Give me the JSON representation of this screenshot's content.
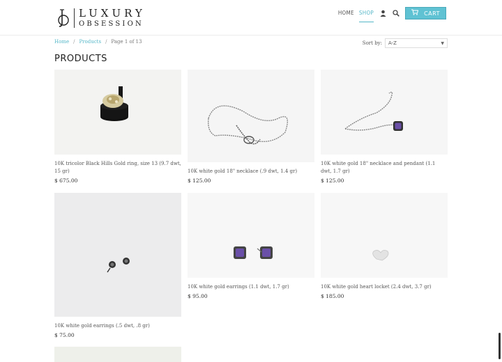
{
  "brand": {
    "line1": "LUXURY",
    "line2": "OBSESSION"
  },
  "nav": {
    "home": "HOME",
    "shop": "SHOP",
    "account_icon": "user-icon",
    "search_icon": "search-icon",
    "cart_label": "CART",
    "cart_icon": "cart-icon",
    "accent_color": "#5fc2d3"
  },
  "breadcrumb": {
    "home": "Home",
    "products": "Products",
    "page": "Page 1 of 13"
  },
  "sort": {
    "label": "Sort by:",
    "value": "A-Z"
  },
  "page_title": "PRODUCTS",
  "products": [
    {
      "name": "10K tricolor Black Hills Gold ring, size 13 (9.7 dwt, 15 gr)",
      "price": "$ 675.00"
    },
    {
      "name": "10K white gold 18\" necklace (.9 dwt, 1.4 gr)",
      "price": "$ 125.00"
    },
    {
      "name": "10K white gold 18\" necklace and pendant (1.1 dwt, 1.7 gr)",
      "price": "$ 125.00"
    },
    {
      "name": "10K white gold earrings (.5 dwt, .8 gr)",
      "price": "$ 75.00"
    },
    {
      "name": "10K white gold earrings (1.1 dwt, 1.7 gr)",
      "price": "$ 95.00"
    },
    {
      "name": "10K white gold heart locket (2.4 dwt, 3.7 gr)",
      "price": "$ 185.00"
    }
  ]
}
